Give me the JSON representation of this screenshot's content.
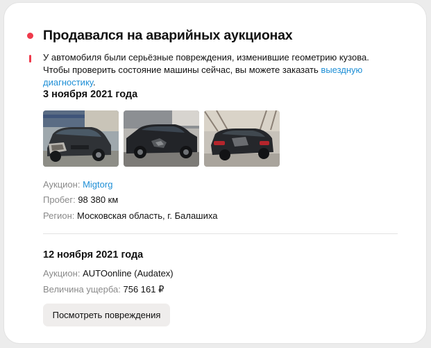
{
  "section": {
    "title": "Продавался на аварийных аукционах",
    "notice": {
      "text_before": "У автомобиля были серьёзные повреждения, изменившие геометрию кузова. Чтобы проверить состояние машины сейчас, вы можете заказать ",
      "link": "выездную диагностику",
      "text_after": "."
    }
  },
  "auctions": [
    {
      "date": "3 ноября 2021 года",
      "photos": [
        {
          "subject": "damaged-car-front-photo"
        },
        {
          "subject": "damaged-car-side-photo"
        },
        {
          "subject": "damaged-car-rear-photo"
        }
      ],
      "auction_label": "Аукцион:",
      "auction_value": "Migtorg",
      "mileage_label": "Пробег:",
      "mileage_value": "98 380 км",
      "region_label": "Регион:",
      "region_value": "Московская область, г. Балашиха"
    },
    {
      "date": "12 ноября 2021 года",
      "auction_label": "Аукцион:",
      "auction_value": "AUTOonline (Audatex)",
      "damage_label": "Величина ущерба:",
      "damage_value": "756 161 ₽",
      "button": "Посмотреть повреждения"
    }
  ],
  "colors": {
    "accent_red": "#ef3a4b",
    "link_blue": "#1e8fd6",
    "label_gray": "#8a8a8a",
    "button_bg": "#efedec"
  }
}
